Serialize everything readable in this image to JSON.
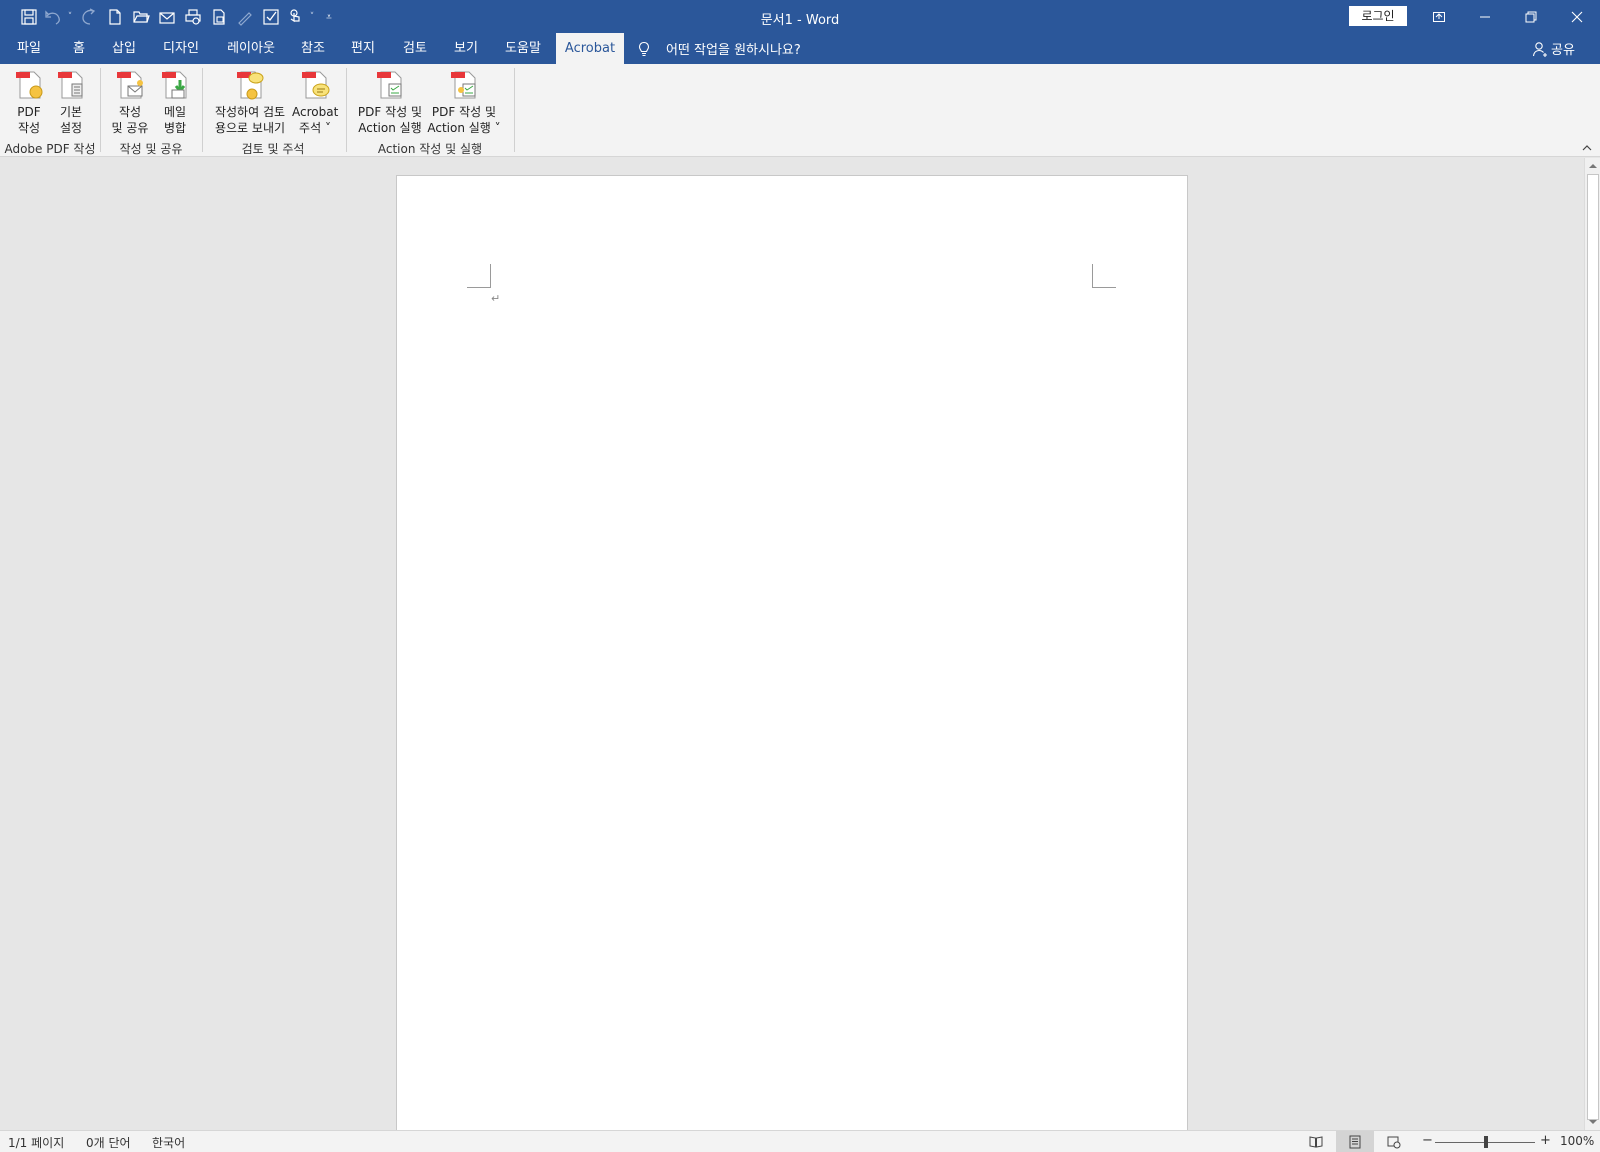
{
  "window": {
    "title": "문서1  -  Word",
    "login_label": "로그인"
  },
  "quick_access": {
    "icons": [
      "save-icon",
      "undo-icon",
      "undo-dropdown-icon",
      "redo-icon",
      "new-document-icon",
      "open-folder-icon",
      "email-icon",
      "print-preview-icon",
      "quick-print-icon",
      "draw-icon",
      "spelling-icon",
      "touch-mode-icon",
      "touch-mode-dropdown-icon",
      "customize-qat-icon"
    ]
  },
  "tabs": [
    {
      "label": "파일"
    },
    {
      "label": "홈"
    },
    {
      "label": "삽입"
    },
    {
      "label": "디자인"
    },
    {
      "label": "레이아웃"
    },
    {
      "label": "참조"
    },
    {
      "label": "편지"
    },
    {
      "label": "검토"
    },
    {
      "label": "보기"
    },
    {
      "label": "도움말"
    },
    {
      "label": "Acrobat"
    }
  ],
  "active_tab": "Acrobat",
  "tell_me": "어떤 작업을 원하시나요?",
  "share_label": "공유",
  "ribbon": {
    "buttons": [
      {
        "label": "PDF\n작성"
      },
      {
        "label": "기본\n설정"
      },
      {
        "label": "작성\n및 공유"
      },
      {
        "label": "메일\n병합"
      },
      {
        "label": "작성하여 검토\n용으로 보내기"
      },
      {
        "label": "Acrobat\n주석 ˅"
      },
      {
        "label": "PDF 작성 및\nAction 실행"
      },
      {
        "label": "PDF 작성 및\nAction 실행 ˅"
      }
    ],
    "groups": [
      {
        "label": "Adobe PDF 작성"
      },
      {
        "label": "작성 및 공유"
      },
      {
        "label": "검토 및 주석"
      },
      {
        "label": "Action 작성 및 실행"
      }
    ]
  },
  "document": {
    "paragraph_mark": "↵"
  },
  "status": {
    "page": "1/1 페이지",
    "words": "0개 단어",
    "language": "한국어",
    "zoom_minus": "−",
    "zoom_plus": "+",
    "zoom": "100%",
    "zoom_level": 100
  },
  "colors": {
    "title_bar": "#2b579a",
    "ribbon_bg": "#f3f3f3",
    "acrobat_red": "#e8373a"
  }
}
